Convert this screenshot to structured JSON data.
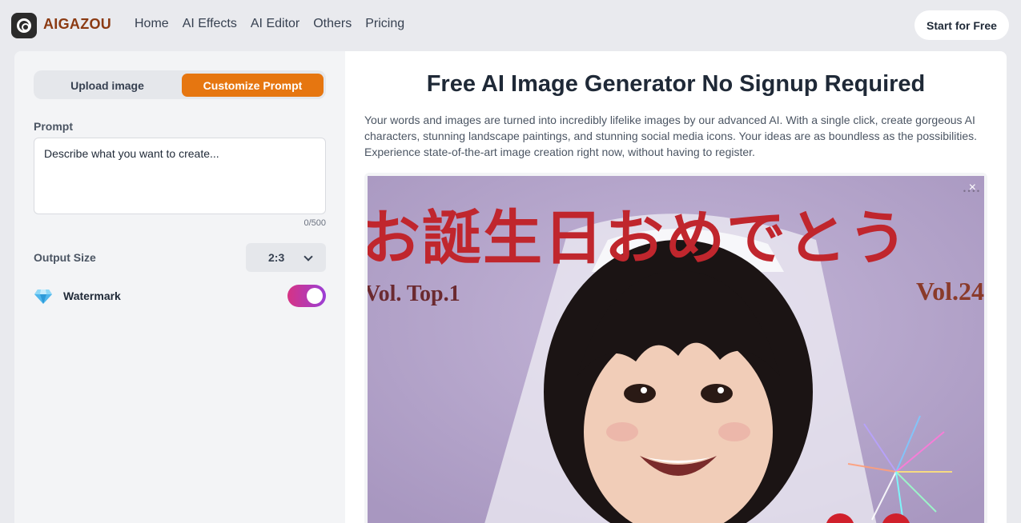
{
  "header": {
    "brand": "AIGAZOU",
    "nav": [
      "Home",
      "AI Effects",
      "AI Editor",
      "Others",
      "Pricing"
    ],
    "cta": "Start for Free"
  },
  "left": {
    "tabs": {
      "upload": "Upload image",
      "prompt": "Customize Prompt",
      "active": "prompt"
    },
    "prompt_label": "Prompt",
    "prompt_placeholder": "Describe what you want to create...",
    "prompt_value": "",
    "counter": "0/500",
    "output_size_label": "Output Size",
    "output_size_value": "2:3",
    "watermark_label": "Watermark",
    "watermark_on": true
  },
  "right": {
    "title": "Free AI Image Generator No Signup Required",
    "description": "Your words and images are turned into incredibly lifelike images by our advanced AI. With a single click, create gorgeous AI characters, stunning landscape paintings, and stunning social media icons. Your ideas are as boundless as the possibilities. Experience state-of-the-art image creation right now, without having to register.",
    "image": {
      "title_text": "お誕生日おめでとう",
      "vol_left": "Vol.  Top.1",
      "vol_right": "Vol.24",
      "close": "×"
    }
  },
  "colors": {
    "accent_orange": "#e67610",
    "brand_brown": "#8b3a12",
    "toggle_pink": "#d63384",
    "toggle_purple": "#9b3fd6",
    "jp_title_red": "#c0262d"
  },
  "icons": [
    "aperture-logo-icon",
    "chevron-down-icon",
    "diamond-gem-icon",
    "close-icon"
  ]
}
